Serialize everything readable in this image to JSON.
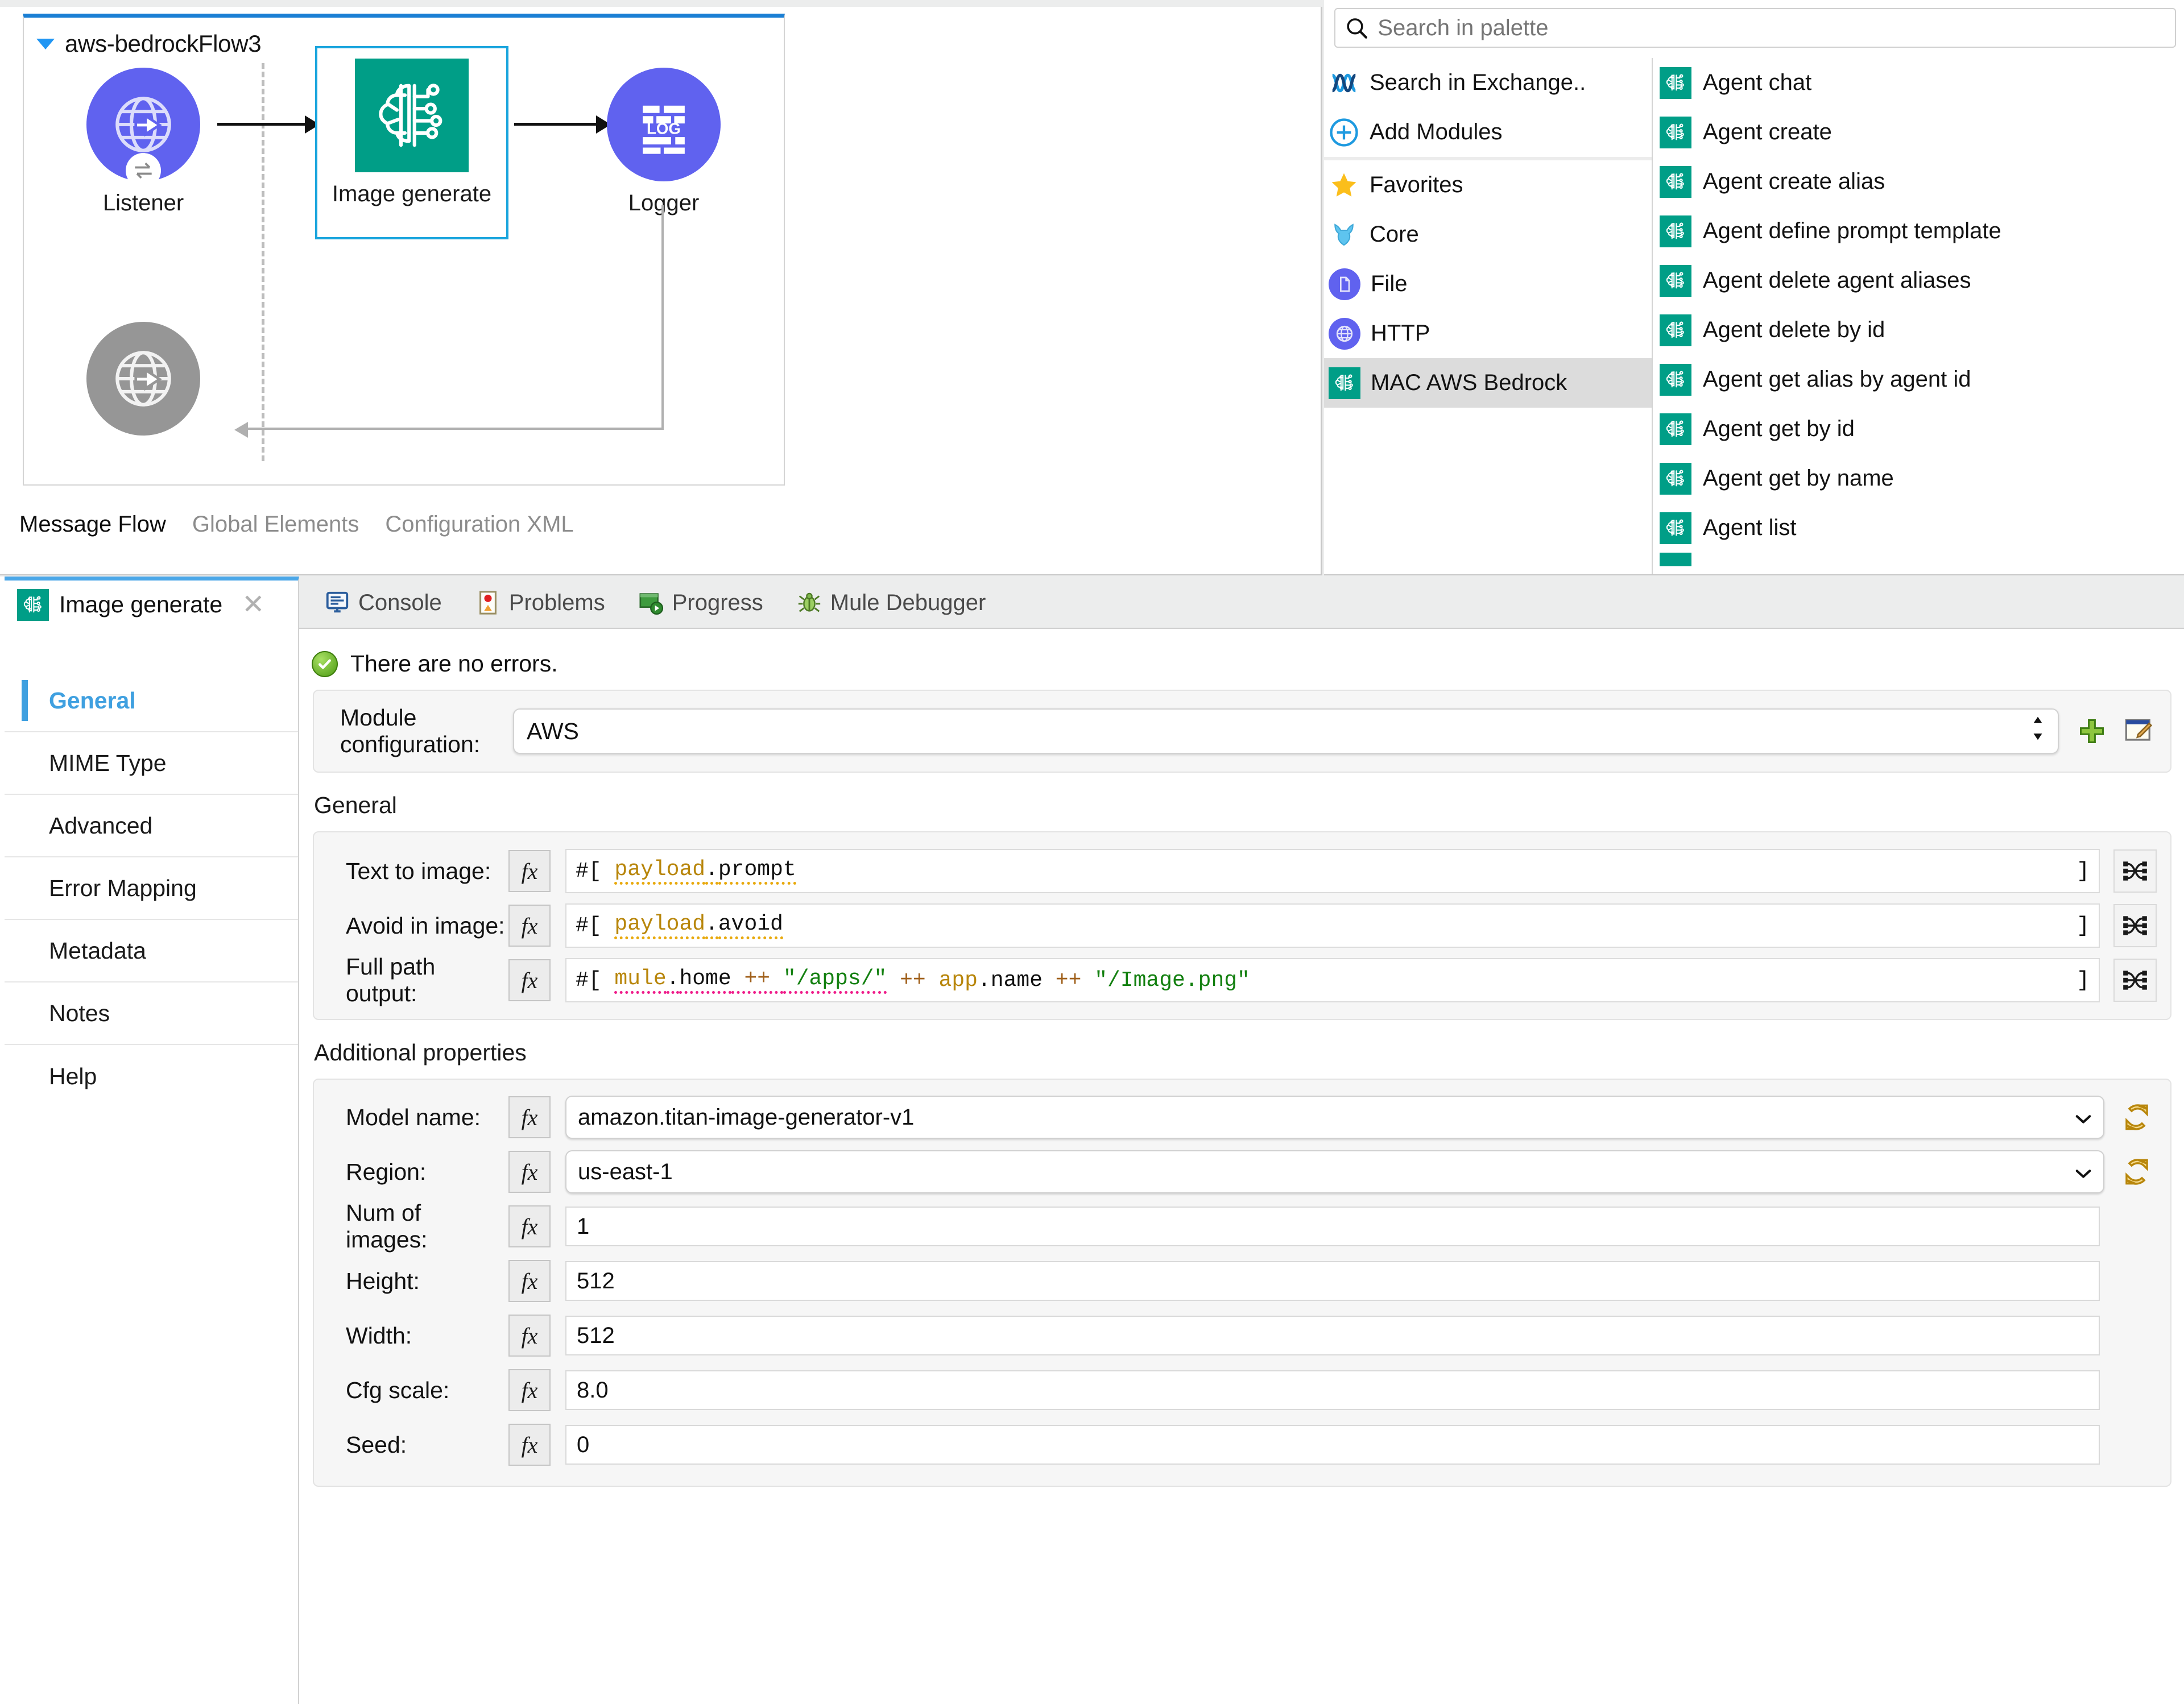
{
  "canvas": {
    "flow_name": "aws-bedrockFlow3",
    "nodes": [
      {
        "label": "Listener",
        "icon": "globe-arrow-icon",
        "kind": "source"
      },
      {
        "label": "Image generate",
        "icon": "brain-circuit-icon",
        "kind": "operation",
        "selected": true
      },
      {
        "label": "Logger",
        "icon": "log-icon",
        "kind": "operation"
      }
    ],
    "error_handler_label": "",
    "tabs": [
      {
        "label": "Message Flow",
        "active": true
      },
      {
        "label": "Global Elements",
        "active": false
      },
      {
        "label": "Configuration XML",
        "active": false
      }
    ]
  },
  "palette": {
    "search_placeholder": "Search in palette",
    "search_value": "",
    "categories": [
      {
        "label": "Search in Exchange..",
        "icon": "exchange-icon"
      },
      {
        "label": "Add Modules",
        "icon": "plus-circle-icon"
      },
      {
        "label": "Favorites",
        "icon": "star-icon"
      },
      {
        "label": "Core",
        "icon": "mule-icon"
      },
      {
        "label": "File",
        "icon": "file-icon"
      },
      {
        "label": "HTTP",
        "icon": "http-globe-icon"
      },
      {
        "label": "MAC AWS Bedrock",
        "icon": "brain-circuit-icon",
        "selected": true
      }
    ],
    "operations": [
      "Agent chat",
      "Agent create",
      "Agent create alias",
      "Agent define prompt template",
      "Agent delete agent aliases",
      "Agent delete by id",
      "Agent get alias by agent id",
      "Agent get by id",
      "Agent get by name",
      "Agent list"
    ]
  },
  "bottom": {
    "property_tab": {
      "title": "Image generate",
      "icon": "brain-circuit-icon",
      "close": "×"
    },
    "view_tabs": [
      {
        "label": "Console",
        "icon": "console-icon"
      },
      {
        "label": "Problems",
        "icon": "problems-icon"
      },
      {
        "label": "Progress",
        "icon": "progress-icon"
      },
      {
        "label": "Mule Debugger",
        "icon": "bug-icon"
      }
    ],
    "left_nav": [
      {
        "label": "General",
        "active": true
      },
      {
        "label": "MIME Type",
        "active": false
      },
      {
        "label": "Advanced",
        "active": false
      },
      {
        "label": "Error Mapping",
        "active": false
      },
      {
        "label": "Metadata",
        "active": false
      },
      {
        "label": "Notes",
        "active": false
      },
      {
        "label": "Help",
        "active": false
      }
    ],
    "status": {
      "icon": "success-icon",
      "text": "There are no errors."
    },
    "module_config": {
      "label": "Module configuration:",
      "value": "AWS",
      "add_icon": "green-plus-icon",
      "edit_icon": "edit-config-icon"
    },
    "general_section": {
      "title": "General",
      "fields": [
        {
          "label": "Text to image:",
          "fx": "fx",
          "value": "#[ payload.prompt",
          "close_bracket": "]",
          "tokens": [
            {
              "t": "#[ ",
              "c": "black"
            },
            {
              "t": "payload",
              "c": "dw-underline-amber"
            },
            {
              "t": ".",
              "c": "black"
            },
            {
              "t": "prompt",
              "c": "black-underline-amber"
            }
          ],
          "map_icon": "transform-icon"
        },
        {
          "label": "Avoid in image:",
          "fx": "fx",
          "value": "#[ payload.avoid",
          "close_bracket": "]",
          "tokens": [
            {
              "t": "#[ ",
              "c": "black"
            },
            {
              "t": "payload",
              "c": "dw-underline-amber"
            },
            {
              "t": ".",
              "c": "black"
            },
            {
              "t": "avoid",
              "c": "black-underline-amber"
            }
          ],
          "map_icon": "transform-icon"
        },
        {
          "label": "Full path output:",
          "fx": "fx",
          "value": "#[ mule.home ++ \"/apps/\" ++ app.name ++ \"/Image.png\"",
          "close_bracket": "]",
          "map_icon": "transform-icon"
        }
      ]
    },
    "additional_section": {
      "title": "Additional properties",
      "fields": [
        {
          "label": "Model name:",
          "fx": "fx",
          "value": "amazon.titan-image-generator-v1",
          "type": "combo",
          "sync_icon": "refresh-icon"
        },
        {
          "label": "Region:",
          "fx": "fx",
          "value": "us-east-1",
          "type": "combo",
          "sync_icon": "refresh-icon"
        },
        {
          "label": "Num of images:",
          "fx": "fx",
          "value": "1",
          "type": "text"
        },
        {
          "label": "Height:",
          "fx": "fx",
          "value": "512",
          "type": "text"
        },
        {
          "label": "Width:",
          "fx": "fx",
          "value": "512",
          "type": "text"
        },
        {
          "label": "Cfg scale:",
          "fx": "fx",
          "value": "8.0",
          "type": "text"
        },
        {
          "label": "Seed:",
          "fx": "fx",
          "value": "0",
          "type": "text"
        }
      ]
    }
  },
  "colors": {
    "mule_purple": "#6062ef",
    "bedrock_teal": "#009e87",
    "selection_blue": "#1aa5dd",
    "active_tab_blue": "#3fa0e0",
    "gray_node": "#969696"
  }
}
